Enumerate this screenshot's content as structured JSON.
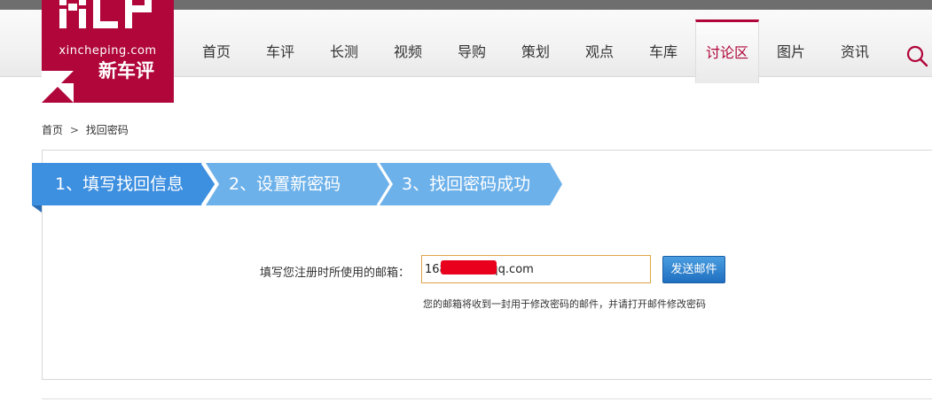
{
  "logo": {
    "mark": "XCP",
    "domain": "xincheping.com",
    "name_cn": "新车评"
  },
  "nav": {
    "items": [
      {
        "label": "首页"
      },
      {
        "label": "车评"
      },
      {
        "label": "长测"
      },
      {
        "label": "视频"
      },
      {
        "label": "导购"
      },
      {
        "label": "策划"
      },
      {
        "label": "观点"
      },
      {
        "label": "车库"
      },
      {
        "label": "讨论区",
        "active": true
      },
      {
        "label": "图片"
      },
      {
        "label": "资讯"
      }
    ],
    "search_icon": "search-icon"
  },
  "breadcrumb": {
    "home": "首页",
    "separator": ">",
    "current": "找回密码"
  },
  "steps": [
    {
      "label": "1、填写找回信息",
      "active": true
    },
    {
      "label": "2、设置新密码",
      "active": false
    },
    {
      "label": "3、找回密码成功",
      "active": false
    }
  ],
  "form": {
    "email_label": "填写您注册时所使用的邮箱：",
    "email_value": "168          0qq.com",
    "send_button": "发送邮件",
    "hint": "您的邮箱将收到一封用于修改密码的邮件，并请打开邮件修改密码"
  },
  "colors": {
    "brand": "#b0063a",
    "step_active": "#3d8fe0",
    "step_inactive": "#6db1ea",
    "button": "#1f6fc0",
    "input_border": "#e0a44a"
  }
}
